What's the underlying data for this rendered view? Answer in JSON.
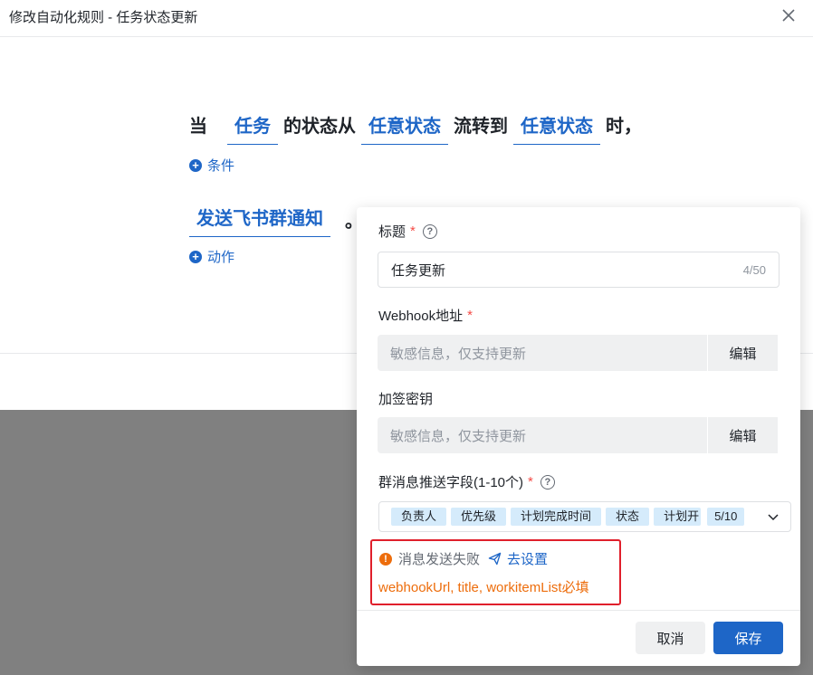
{
  "dialog": {
    "title": "修改自动化规则 - 任务状态更新"
  },
  "rule": {
    "prefix": "当",
    "entity": "任务",
    "middle1": "的状态从",
    "from_status": "任意状态",
    "middle2": "流转到",
    "to_status": "任意状态",
    "suffix": "时，",
    "add_condition": "条件",
    "action": "发送飞书群通知",
    "action_suffix": "。",
    "add_action": "动作"
  },
  "panel": {
    "title_label": "标题",
    "title_value": "任务更新",
    "title_counter": "4/50",
    "webhook_label": "Webhook地址",
    "webhook_placeholder": "敏感信息，仅支持更新",
    "webhook_edit": "编辑",
    "secret_label": "加签密钥",
    "secret_placeholder": "敏感信息，仅支持更新",
    "secret_edit": "编辑",
    "fields_label": "群消息推送字段(1-10个)",
    "tags": [
      "负责人",
      "优先级",
      "计划完成时间",
      "状态",
      "计划开"
    ],
    "tags_count": "5/10",
    "error_title": "消息发送失败",
    "error_link": "去设置",
    "error_detail": "webhookUrl, title, workitemList必填",
    "cancel": "取消",
    "save": "保存"
  },
  "colors": {
    "accent": "#1e66c7",
    "error": "#ed6d0c",
    "highlight": "#e01f2b"
  }
}
